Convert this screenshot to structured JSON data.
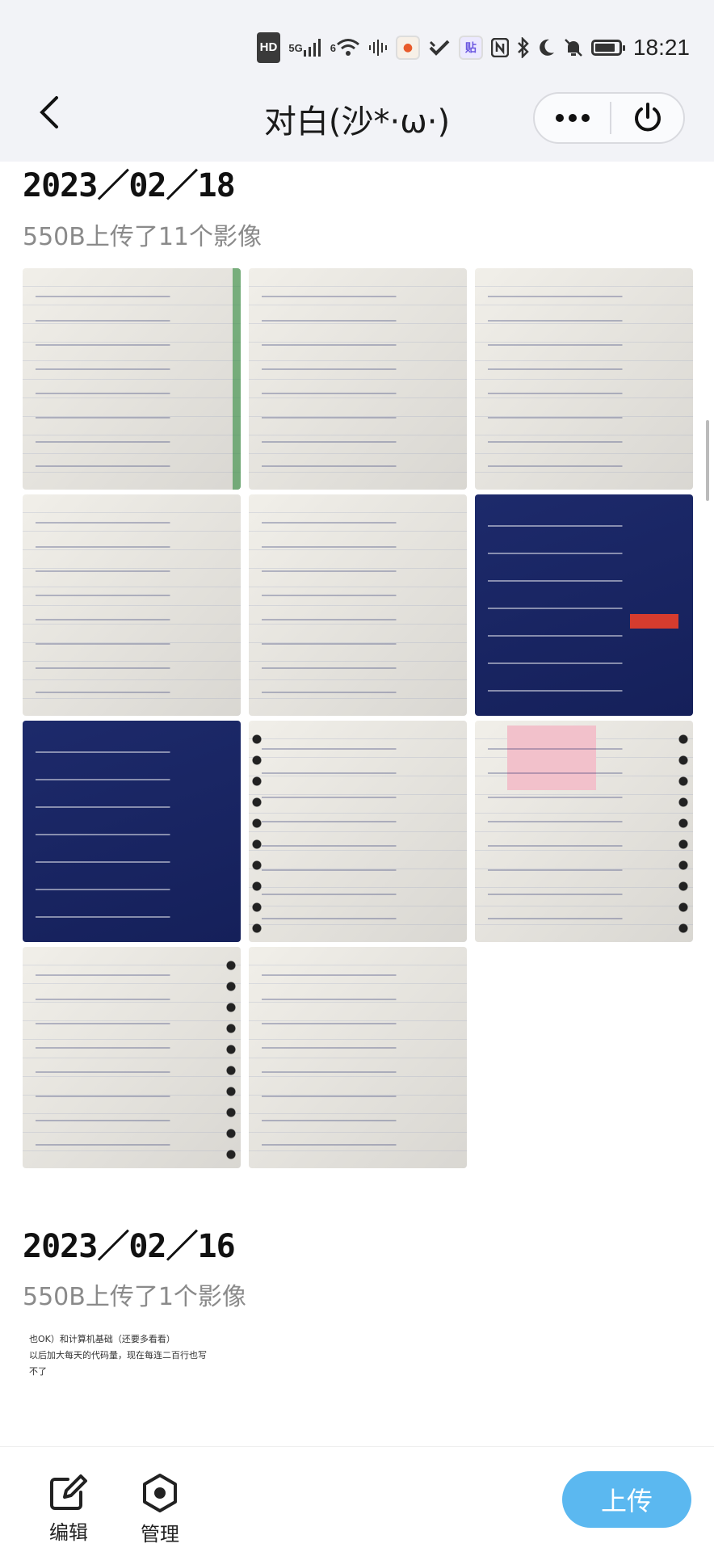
{
  "status_bar": {
    "hd": "HD",
    "signal": "5G",
    "signal2": "6",
    "app_badge_1": "●",
    "app_badge_2": "贴",
    "time": "18:21",
    "icons": [
      "hd-icon",
      "signal-icon",
      "wifi-icon",
      "audio-icon",
      "app-icon",
      "check-icon",
      "app-badge-icon",
      "nfc-icon",
      "bluetooth-icon",
      "moon-icon",
      "mute-icon",
      "battery-icon"
    ]
  },
  "nav": {
    "title": "对白(沙*·ω·)",
    "more_icon": "more-dots-icon",
    "close_icon": "power-icon"
  },
  "sections": [
    {
      "date": "2023／02／18",
      "subtitle": "550B上传了11个影像",
      "photos": [
        {
          "kind": "paper"
        },
        {
          "kind": "paper"
        },
        {
          "kind": "paper"
        },
        {
          "kind": "paper"
        },
        {
          "kind": "paper"
        },
        {
          "kind": "slide"
        },
        {
          "kind": "slide"
        },
        {
          "kind": "paper"
        },
        {
          "kind": "paper"
        },
        {
          "kind": "paper"
        },
        {
          "kind": "paper"
        }
      ]
    },
    {
      "date": "2023／02／16",
      "subtitle": "550B上传了1个影像",
      "note_lines": [
        "也OK）和计算机基础（还要多看看）",
        "以后加大每天的代码量，现在每连二百行也写",
        "不了"
      ]
    }
  ],
  "bottom_bar": {
    "edit_label": "编辑",
    "manage_label": "管理",
    "upload_label": "上传",
    "accent": "#5bb8f0"
  }
}
